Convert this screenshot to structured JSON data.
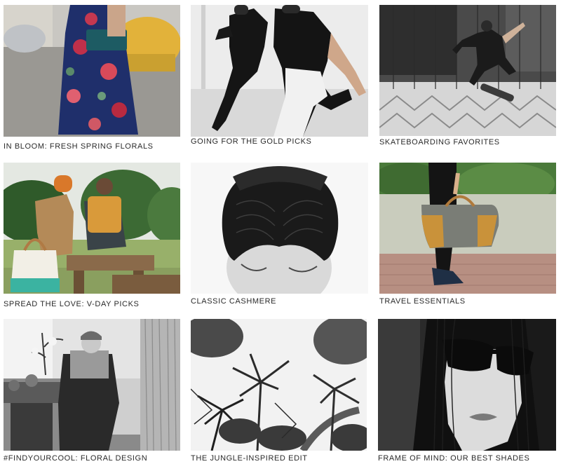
{
  "grid": {
    "tiles": [
      {
        "caption": "IN BLOOM: FRESH SPRING FLORALS",
        "image": "woman-floral-skirt-street-photo"
      },
      {
        "caption": "GOING FOR THE GOLD PICKS",
        "image": "two-men-running-photo"
      },
      {
        "caption": "SKATEBOARDING FAVORITES",
        "image": "skateboarder-jump-photo"
      },
      {
        "caption": "SPREAD THE LOVE: V-DAY PICKS",
        "image": "couple-on-bench-photo"
      },
      {
        "caption": "CLASSIC CASHMERE",
        "image": "knit-headband-photo"
      },
      {
        "caption": "TRAVEL ESSENTIALS",
        "image": "duffel-bag-photo"
      },
      {
        "caption": "#FINDYOURCOOL: FLORAL DESIGN",
        "image": "woman-in-chair-photo"
      },
      {
        "caption": "THE JUNGLE-INSPIRED EDIT",
        "image": "palm-trees-photo"
      },
      {
        "caption": "FRAME OF MIND: OUR BEST SHADES",
        "image": "woman-sunglasses-photo"
      }
    ]
  }
}
